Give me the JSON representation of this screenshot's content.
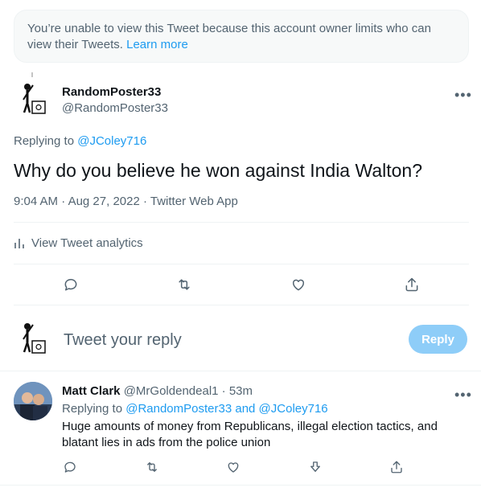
{
  "notice": {
    "text": "You’re unable to view this Tweet because this account owner limits who can view their Tweets.",
    "link": "Learn more"
  },
  "main_tweet": {
    "name": "RandomPoster33",
    "handle": "@RandomPoster33",
    "replying_prefix": "Replying to",
    "replying_to": "@JColey716",
    "text": "Why do you believe he won against India Walton?",
    "time": "9:04 AM",
    "date": "Aug 27, 2022",
    "source": "Twitter Web App",
    "separator": "·",
    "analytics_label": "View Tweet analytics",
    "more": "•••"
  },
  "reply_box": {
    "placeholder": "Tweet your reply",
    "button": "Reply"
  },
  "reply_tweet": {
    "name": "Matt Clark",
    "handle": "@MrGoldendeal1",
    "separator": "·",
    "age": "53m",
    "replying_prefix": "Replying to",
    "replying_to": "@RandomPoster33 and @JColey716",
    "text": "Huge amounts of money from Republicans, illegal election tactics, and blatant lies in ads from the police union",
    "more": "•••"
  },
  "icons": [
    "comment-icon",
    "retweet-icon",
    "like-icon",
    "share-icon",
    "analytics-icon",
    "downvote-icon"
  ],
  "colors": {
    "accent": "#1d9bf0",
    "muted": "#536471",
    "reply_button": "#8ecdf8"
  }
}
